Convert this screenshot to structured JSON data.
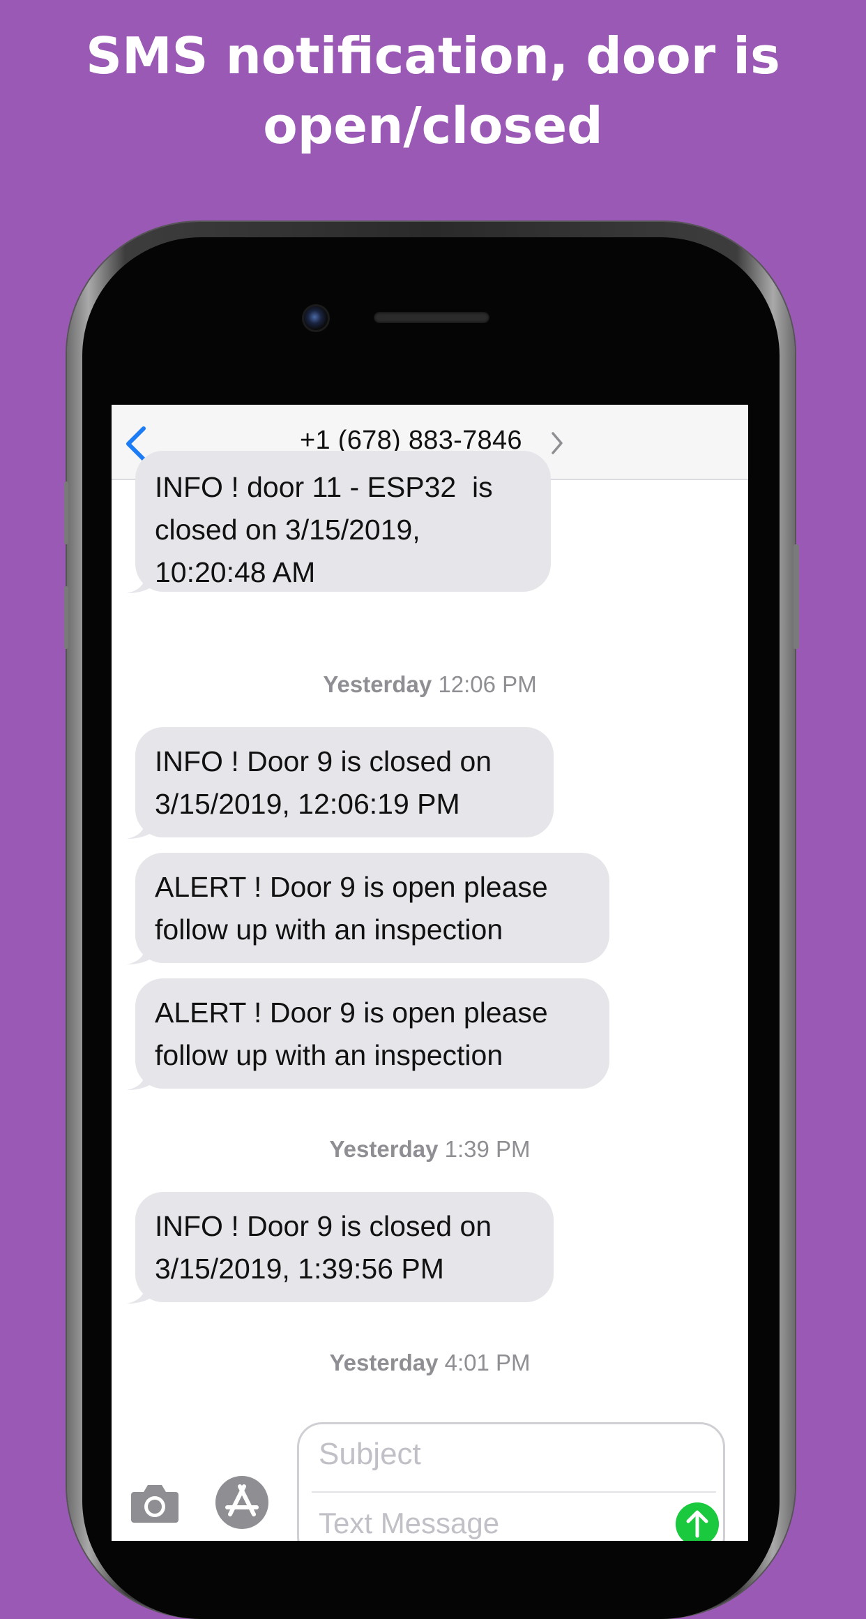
{
  "headline": {
    "line1": "SMS notification, door is",
    "line2": "open/closed"
  },
  "colors": {
    "background": "#9b59b6",
    "bubble": "#e5e5ea",
    "ios_blue": "#1b7cf5",
    "send_green": "#1bc93f",
    "timestamp_gray": "#8e8e93"
  },
  "navbar": {
    "contact": "+1 (678) 883-7846",
    "back_icon": "chevron-left-icon",
    "detail_icon": "chevron-right-icon"
  },
  "messages": [
    {
      "lines": [
        "INFO ! door 11 - ESP32  is",
        "closed on 3/15/2019,",
        "10:20:48 AM"
      ]
    },
    {
      "stamp_day": "Yesterday",
      "stamp_time": "12:06 PM"
    },
    {
      "lines": [
        "INFO ! Door 9 is closed on",
        "3/15/2019, 12:06:19 PM"
      ]
    },
    {
      "lines": [
        "ALERT ! Door 9 is open please",
        "follow up with an inspection"
      ]
    },
    {
      "lines": [
        "ALERT ! Door 9 is open please",
        "follow up with an inspection"
      ]
    },
    {
      "stamp_day": "Yesterday",
      "stamp_time": "1:39 PM"
    },
    {
      "lines": [
        "INFO ! Door 9 is closed on",
        "3/15/2019, 1:39:56 PM"
      ]
    },
    {
      "stamp_day": "Yesterday",
      "stamp_time": "4:01 PM"
    }
  ],
  "compose": {
    "subject_placeholder": "Subject",
    "message_placeholder": "Text Message",
    "camera_icon": "camera-icon",
    "appstore_icon": "app-store-icon",
    "send_icon": "send-arrow-icon"
  }
}
